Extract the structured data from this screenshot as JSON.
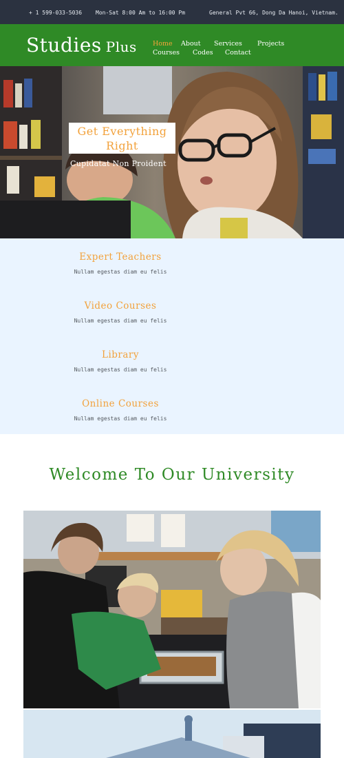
{
  "topbar": {
    "phone": "+ 1 599-033-5036",
    "hours": "Mon-Sat 8:00 Am to 16:00 Pm",
    "address": "General Pvt 66, Dong Da Hanoi, Vietnam."
  },
  "header": {
    "logo_main": "Studies",
    "logo_plus": "Plus",
    "nav": [
      "Home",
      "About",
      "Services",
      "Projects",
      "Courses",
      "Codes",
      "Contact"
    ]
  },
  "hero": {
    "title": "Get Everything Right",
    "subtitle": "Cupidatat Non Proident"
  },
  "features": [
    {
      "title": "Expert Teachers",
      "desc": "Nullam egestas diam eu felis"
    },
    {
      "title": "Video Courses",
      "desc": "Nullam egestas diam eu felis"
    },
    {
      "title": "Library",
      "desc": "Nullam egestas diam eu felis"
    },
    {
      "title": "Online Courses",
      "desc": "Nullam egestas diam eu felis"
    }
  ],
  "welcome": {
    "title": "Welcome To Our University"
  },
  "colors": {
    "topbar_bg": "#2b3240",
    "header_green": "#2f8a26",
    "accent_orange": "#f2a13a",
    "features_bg": "#eaf4ff"
  }
}
